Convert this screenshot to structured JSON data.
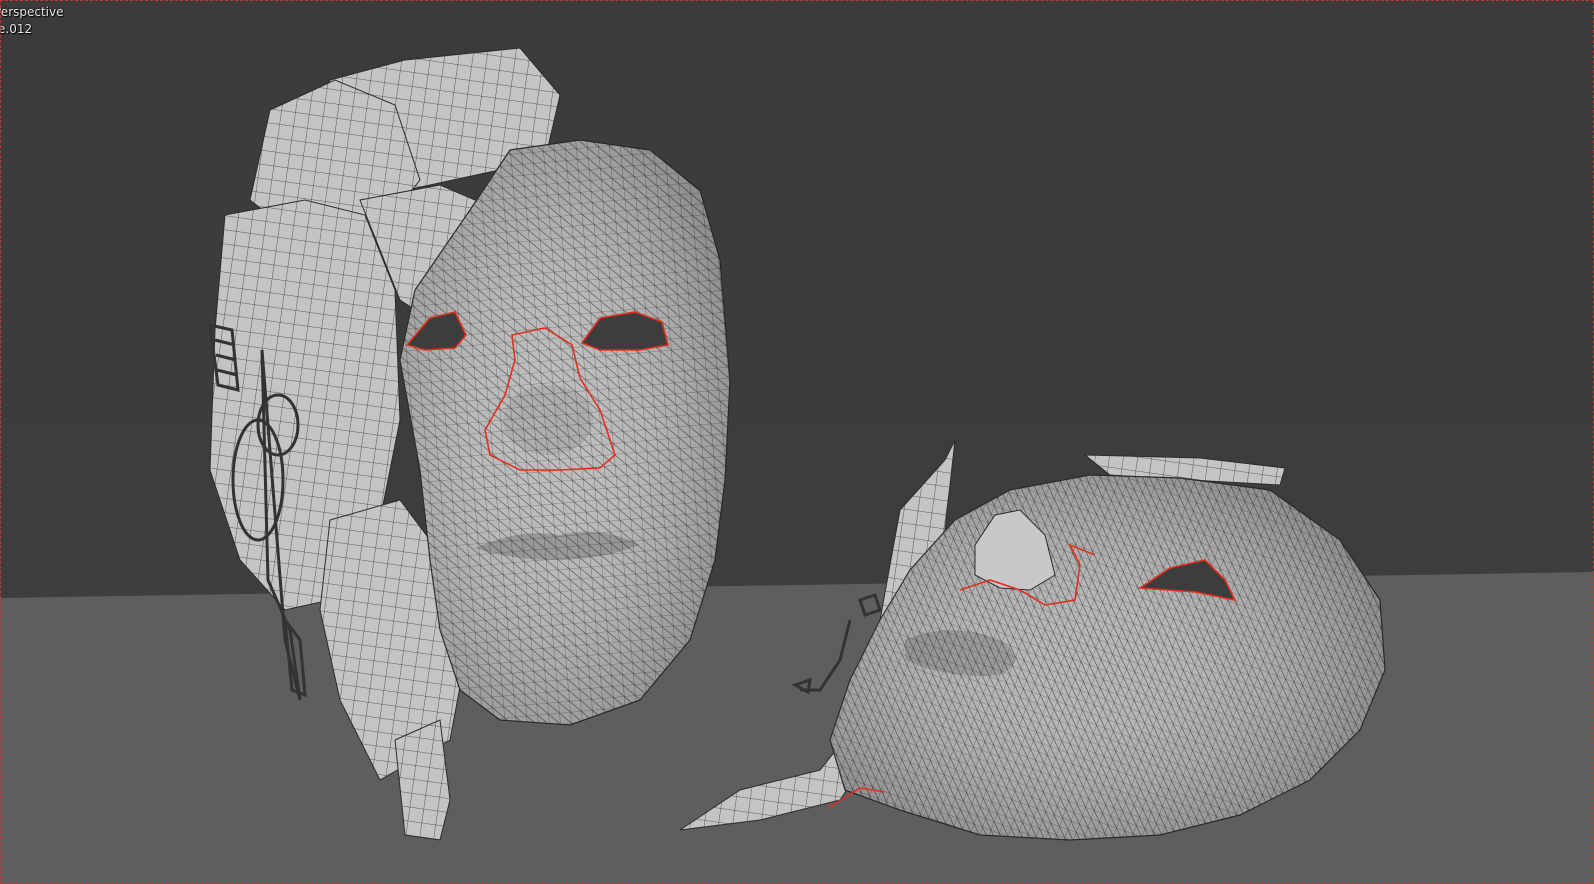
{
  "viewport": {
    "view_label": "Perspective",
    "object_label": "e.012"
  },
  "colors": {
    "background": "#3d3d3d",
    "floor": "#5d5d5d",
    "mesh_surface": "#bdbdbd",
    "wire": "#2f2f2f",
    "seam": "#e0301e"
  },
  "icons": {
    "frame": "viewport-frame"
  }
}
